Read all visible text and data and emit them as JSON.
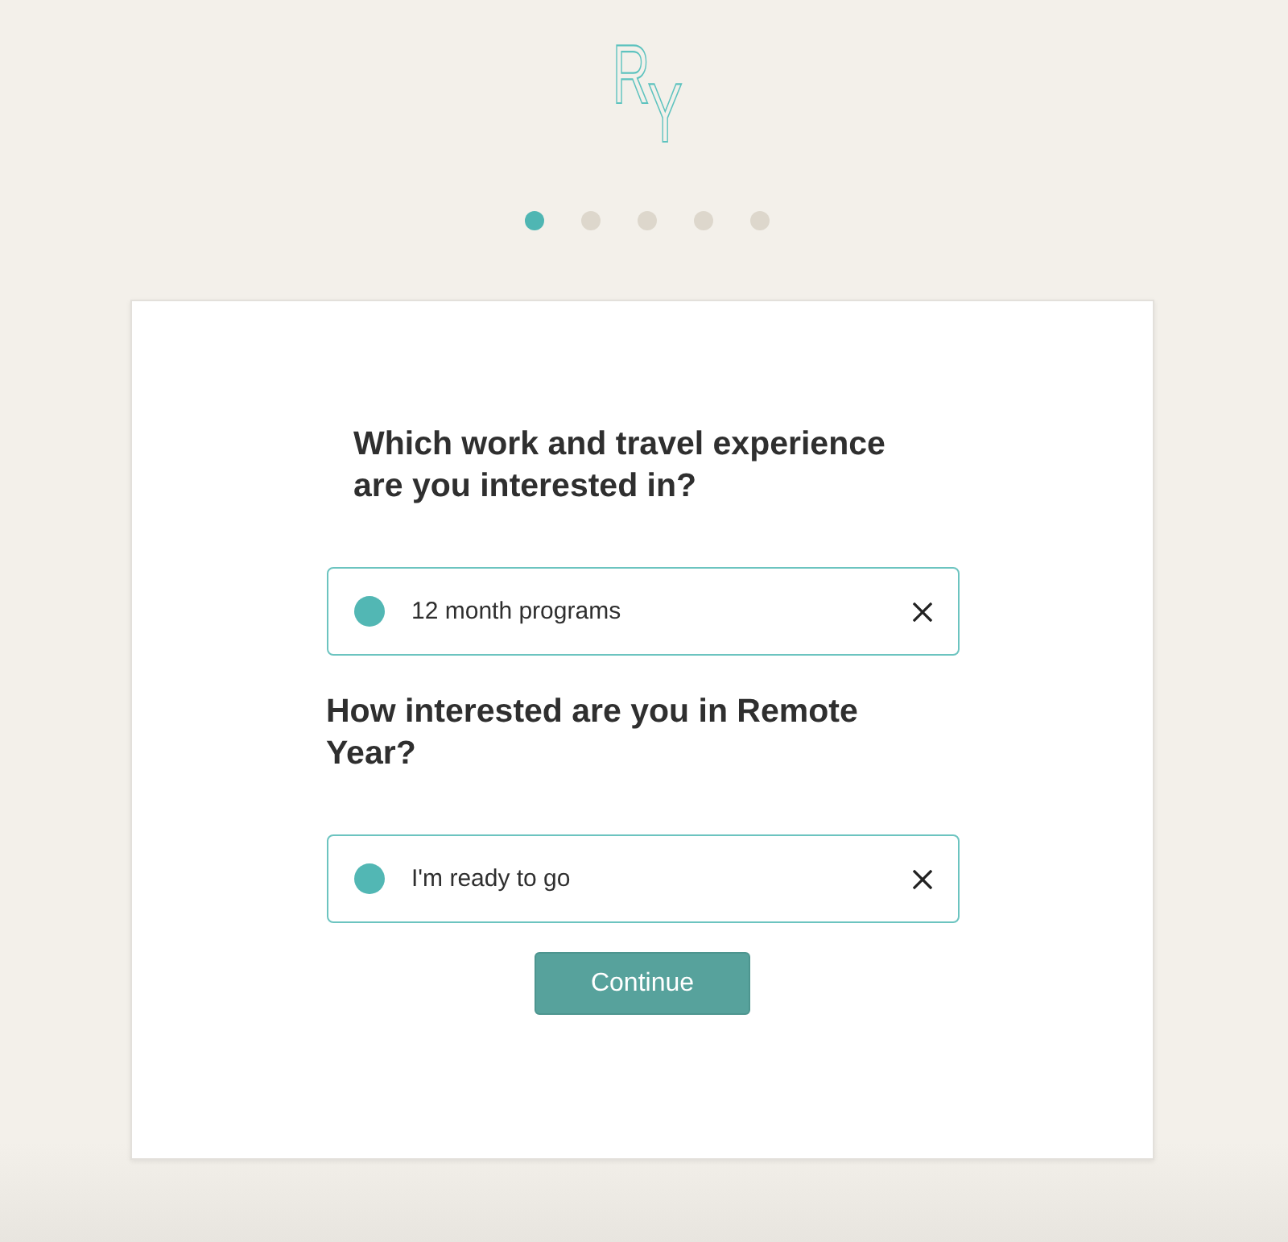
{
  "logo": {
    "text": "RY"
  },
  "steps": [
    {
      "selected": true
    },
    {
      "selected": false
    },
    {
      "selected": false
    },
    {
      "selected": false
    },
    {
      "selected": false
    }
  ],
  "questions": [
    {
      "heading": "Which work and travel experience are you interested in?",
      "answer": "12 month programs"
    },
    {
      "heading": "How interested are you in Remote Year?",
      "answer": "I'm ready to go"
    }
  ],
  "continue_button": {
    "label": "Continue"
  }
}
